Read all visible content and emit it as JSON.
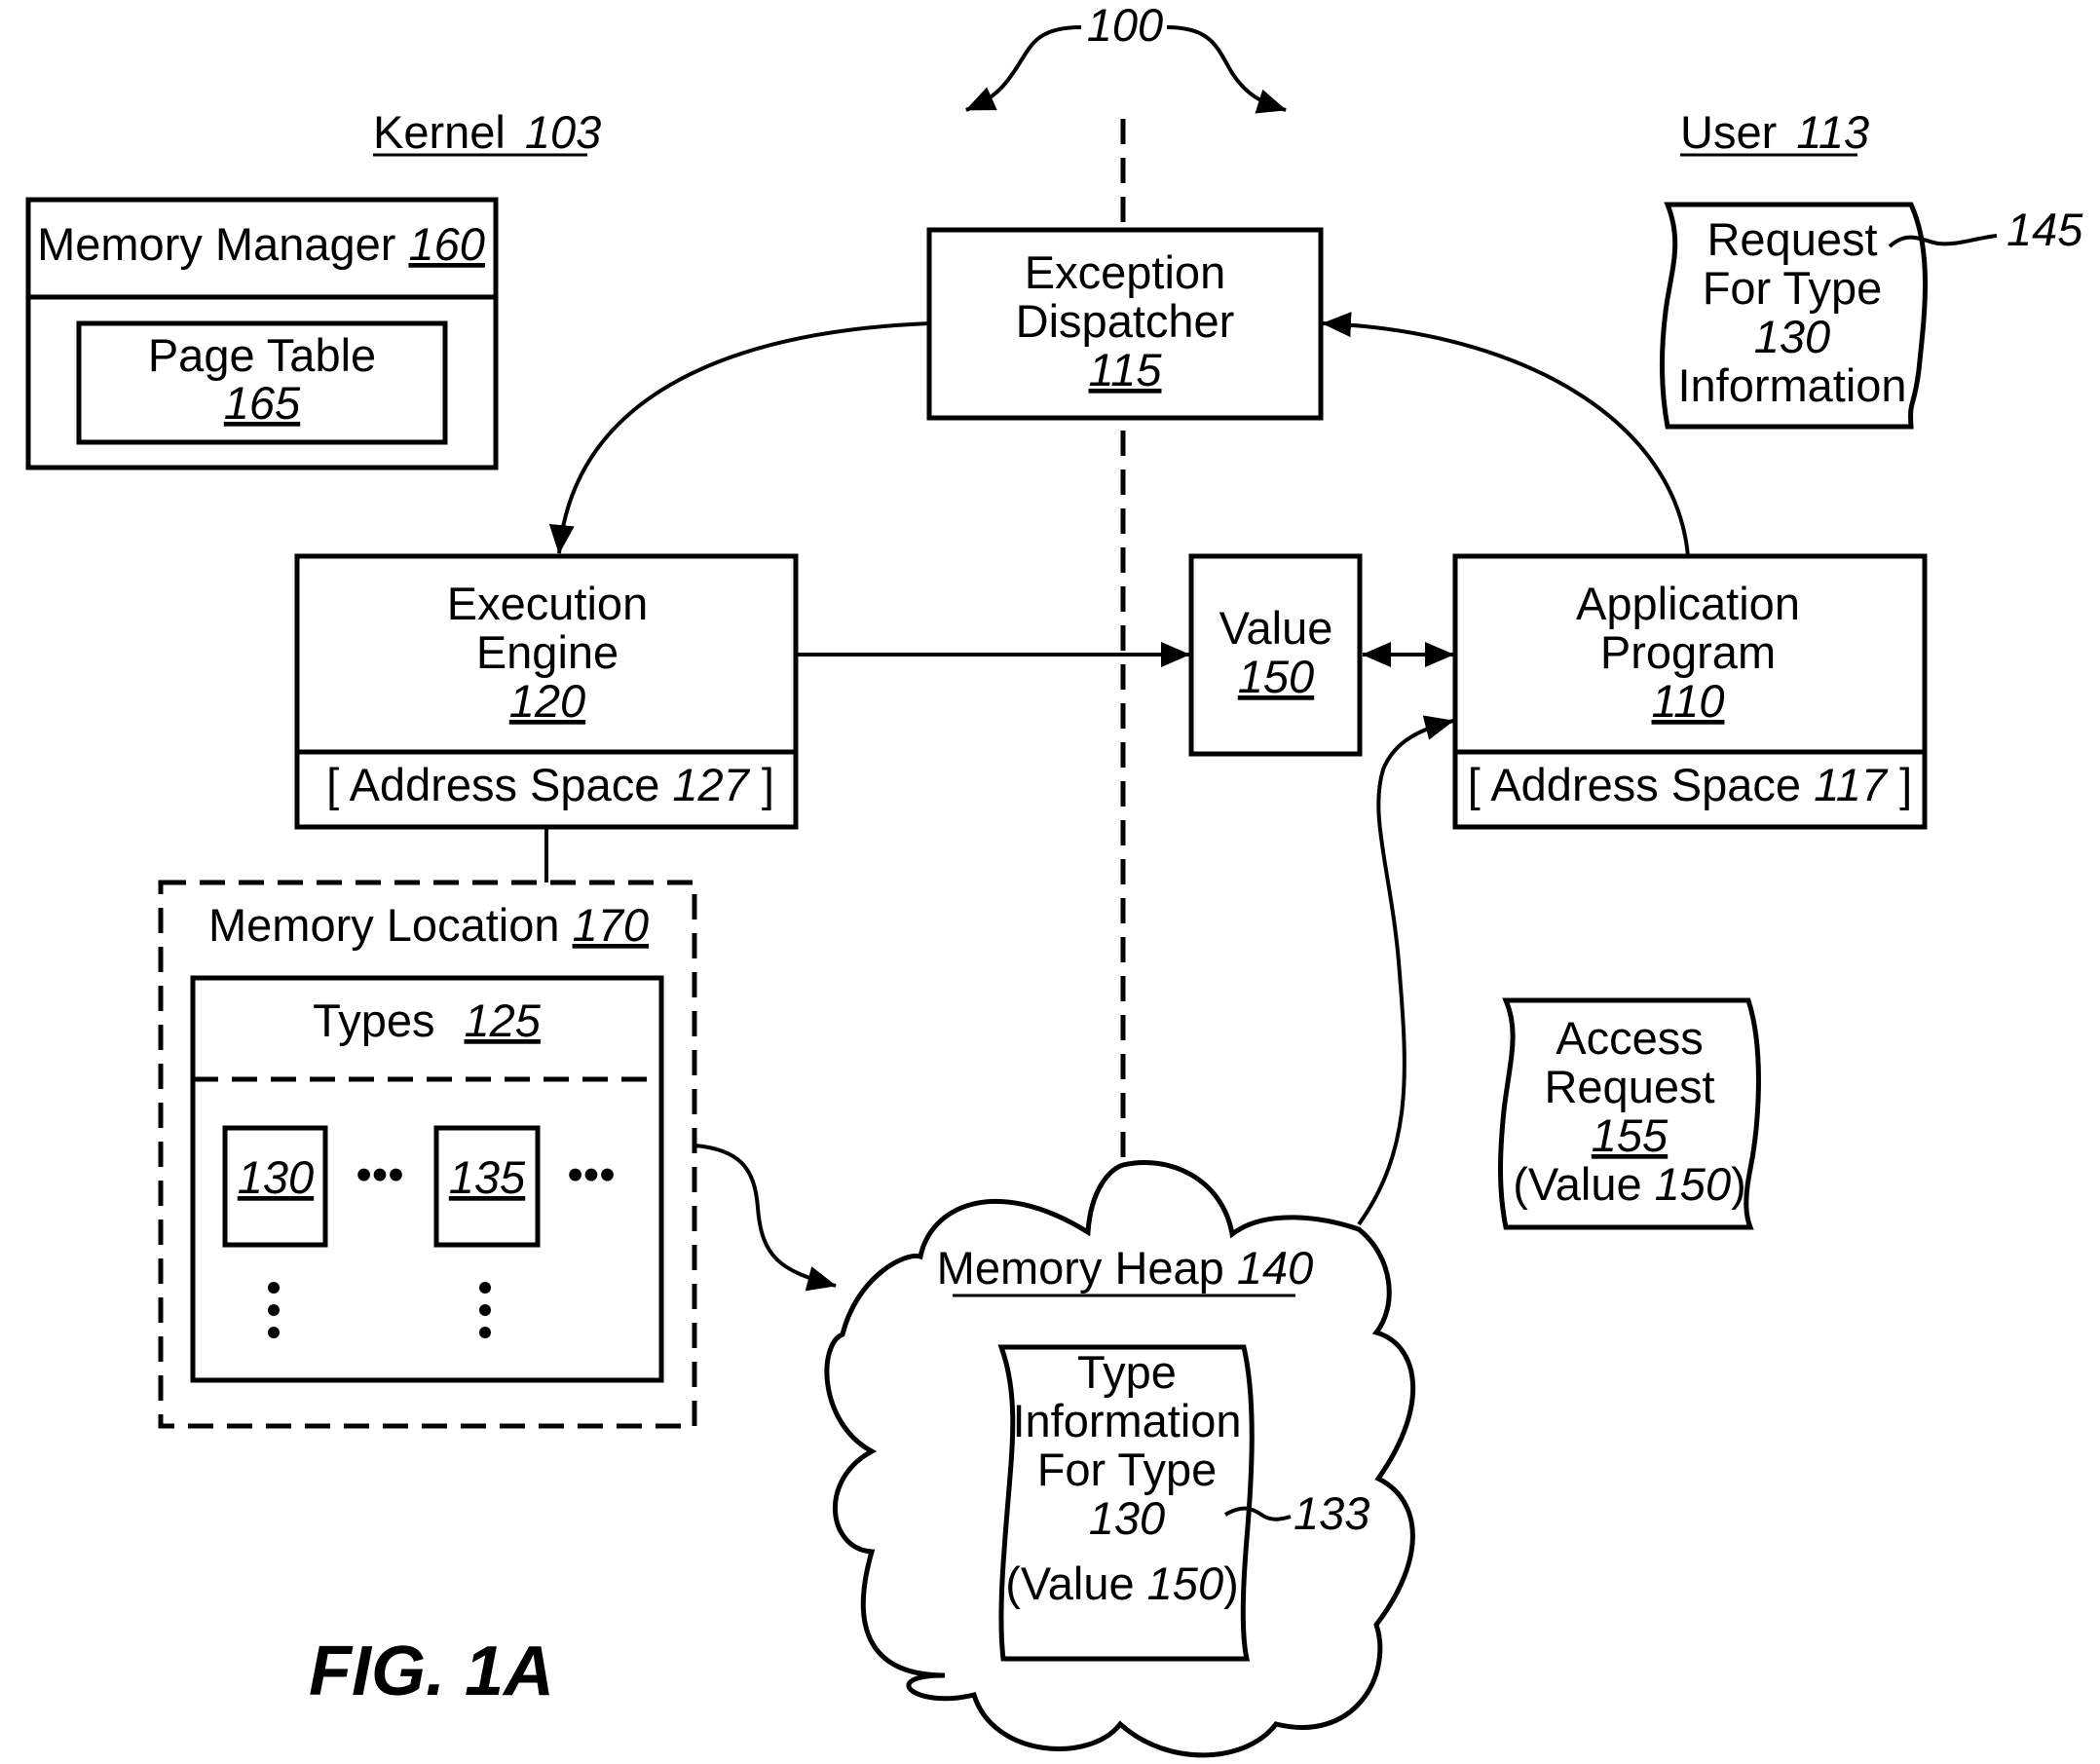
{
  "figure": {
    "ref_number": "100",
    "caption": "FIG.  1A",
    "colors": {
      "line": "#000000",
      "background": "#ffffff"
    }
  },
  "regions": {
    "kernel": {
      "label": "Kernel",
      "ref": "103"
    },
    "user": {
      "label": "User",
      "ref": "113"
    }
  },
  "memory_manager": {
    "label": "Memory Manager",
    "ref": "160",
    "page_table": {
      "label": "Page Table",
      "ref": "165"
    }
  },
  "exception_dispatcher": {
    "line1": "Exception",
    "line2": "Dispatcher",
    "ref": "115"
  },
  "execution_engine": {
    "line1": "Execution",
    "line2": "Engine",
    "ref": "120",
    "address_space": {
      "label": "[ Address Space",
      "ref": "127",
      "close": "]"
    }
  },
  "value": {
    "label": "Value",
    "ref": "150"
  },
  "application_program": {
    "line1": "Application",
    "line2": "Program",
    "ref": "110",
    "address_space": {
      "label": "[ Address Space",
      "ref": "117",
      "close": "]"
    }
  },
  "request_for_type": {
    "line1": "Request",
    "line2": "For Type",
    "line3": "130",
    "line4": "Information",
    "ref": "145"
  },
  "memory_location": {
    "label": "Memory Location",
    "ref": "170",
    "types": {
      "label": "Types",
      "ref": "125",
      "items": [
        {
          "ref": "130"
        },
        {
          "ref": "135"
        }
      ],
      "ellipsis": "•••",
      "vertical_ellipsis": "•"
    }
  },
  "access_request": {
    "line1": "Access",
    "line2": "Request",
    "ref": "155",
    "value_prefix": "(Value",
    "value_ref": "150",
    "value_suffix": ")"
  },
  "memory_heap": {
    "label": "Memory Heap",
    "ref": "140",
    "type_information": {
      "line1": "Type",
      "line2": "Information",
      "line3": "For Type",
      "line4": "130",
      "value_prefix": "(Value",
      "value_ref": "150",
      "value_suffix": ")",
      "ref": "133"
    }
  }
}
